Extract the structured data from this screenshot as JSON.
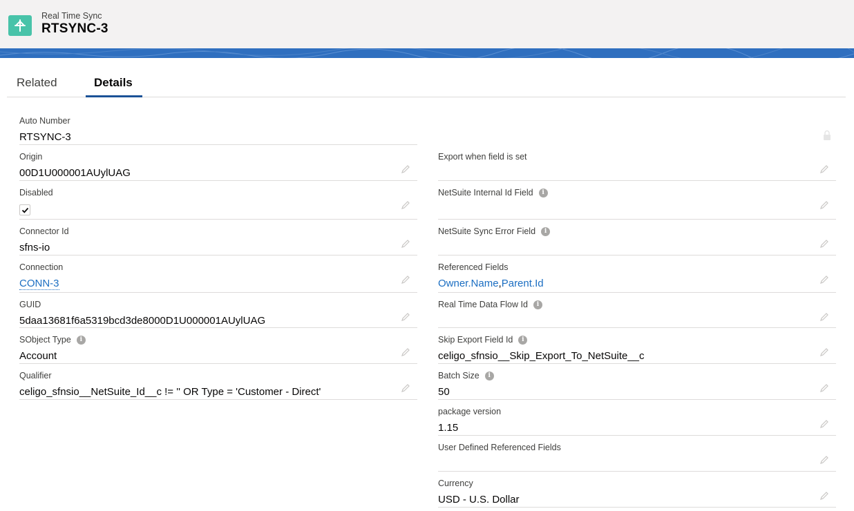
{
  "header": {
    "object_label": "Real Time Sync",
    "record_name": "RTSYNC-3"
  },
  "tabs": [
    {
      "label": "Related"
    },
    {
      "label": "Details"
    }
  ],
  "left_fields": [
    {
      "label": "Auto Number",
      "value": "RTSYNC-3"
    },
    {
      "label": "Origin",
      "value": "00D1U000001AUylUAG"
    },
    {
      "label": "Disabled",
      "checked": true
    },
    {
      "label": "Connector Id",
      "value": "sfns-io"
    },
    {
      "label": "Connection",
      "value": "CONN-3"
    },
    {
      "label": "GUID",
      "value": "5daa13681f6a5319bcd3de8000D1U000001AUylUAG"
    },
    {
      "label": "SObject Type",
      "value": "Account"
    },
    {
      "label": "Qualifier",
      "value": "celigo_sfnsio__NetSuite_Id__c != '' OR Type = 'Customer - Direct'"
    }
  ],
  "right_fields": [
    {
      "label": "Export when field is set",
      "value": ""
    },
    {
      "label": "NetSuite Internal Id Field",
      "value": ""
    },
    {
      "label": "NetSuite Sync Error Field",
      "value": ""
    },
    {
      "label": "Referenced Fields",
      "value_part1": "Owner.Name",
      "separator": ",",
      "value_part2": "Parent.Id"
    },
    {
      "label": "Real Time Data Flow Id",
      "value": ""
    },
    {
      "label": "Skip Export Field Id",
      "value": "celigo_sfnsio__Skip_Export_To_NetSuite__c"
    },
    {
      "label": "Batch Size",
      "value": "50"
    },
    {
      "label": "package version",
      "value": "1.15"
    },
    {
      "label": "User Defined Referenced Fields",
      "value": ""
    },
    {
      "label": "Currency",
      "value": "USD - U.S. Dollar"
    }
  ],
  "info_icon_glyph": "i",
  "colors": {
    "accent": "#1b5297",
    "link": "#1b6ec2",
    "app_icon": "#48c3a9",
    "banner": "#2f6fbf"
  }
}
